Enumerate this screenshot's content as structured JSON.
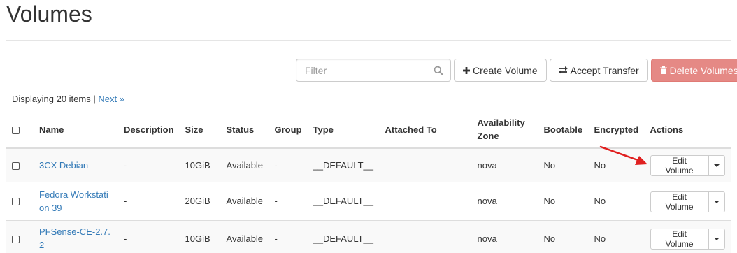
{
  "page": {
    "title": "Volumes"
  },
  "toolbar": {
    "filter_placeholder": "Filter",
    "create_label": "Create Volume",
    "accept_label": "Accept Transfer",
    "delete_label": "Delete Volumes"
  },
  "listing": {
    "count_text": "Displaying 20 items |",
    "next_label": "Next »"
  },
  "table": {
    "headers": {
      "name": "Name",
      "description": "Description",
      "size": "Size",
      "status": "Status",
      "group": "Group",
      "type": "Type",
      "attached_to": "Attached To",
      "availability_zone_line1": "Availability",
      "availability_zone_line2": "Zone",
      "bootable": "Bootable",
      "encrypted": "Encrypted",
      "actions": "Actions"
    },
    "rows": [
      {
        "name": "3CX Debian",
        "description": "-",
        "size": "10GiB",
        "status": "Available",
        "group": "-",
        "type": "__DEFAULT__",
        "attached_to": "",
        "availability_zone": "nova",
        "bootable": "No",
        "encrypted": "No",
        "action_label": "Edit Volume"
      },
      {
        "name_line1": "Fedora Workstati",
        "name_line2": "on 39",
        "description": "-",
        "size": "20GiB",
        "status": "Available",
        "group": "-",
        "type": "__DEFAULT__",
        "attached_to": "",
        "availability_zone": "nova",
        "bootable": "No",
        "encrypted": "No",
        "action_label": "Edit Volume"
      },
      {
        "name_line1": "PFSense-CE-2.7.",
        "name_line2": "2",
        "description": "-",
        "size": "10GiB",
        "status": "Available",
        "group": "-",
        "type": "__DEFAULT__",
        "attached_to": "",
        "availability_zone": "nova",
        "bootable": "No",
        "encrypted": "No",
        "action_label": "Edit Volume"
      }
    ]
  },
  "colors": {
    "link": "#337ab7",
    "danger_button": "#e58985",
    "annotation_arrow": "#e02020"
  },
  "icons": {
    "filter": "search-icon",
    "create": "plus-icon",
    "accept": "exchange-icon",
    "delete": "trash-icon",
    "action_menu": "caret-down-icon"
  }
}
